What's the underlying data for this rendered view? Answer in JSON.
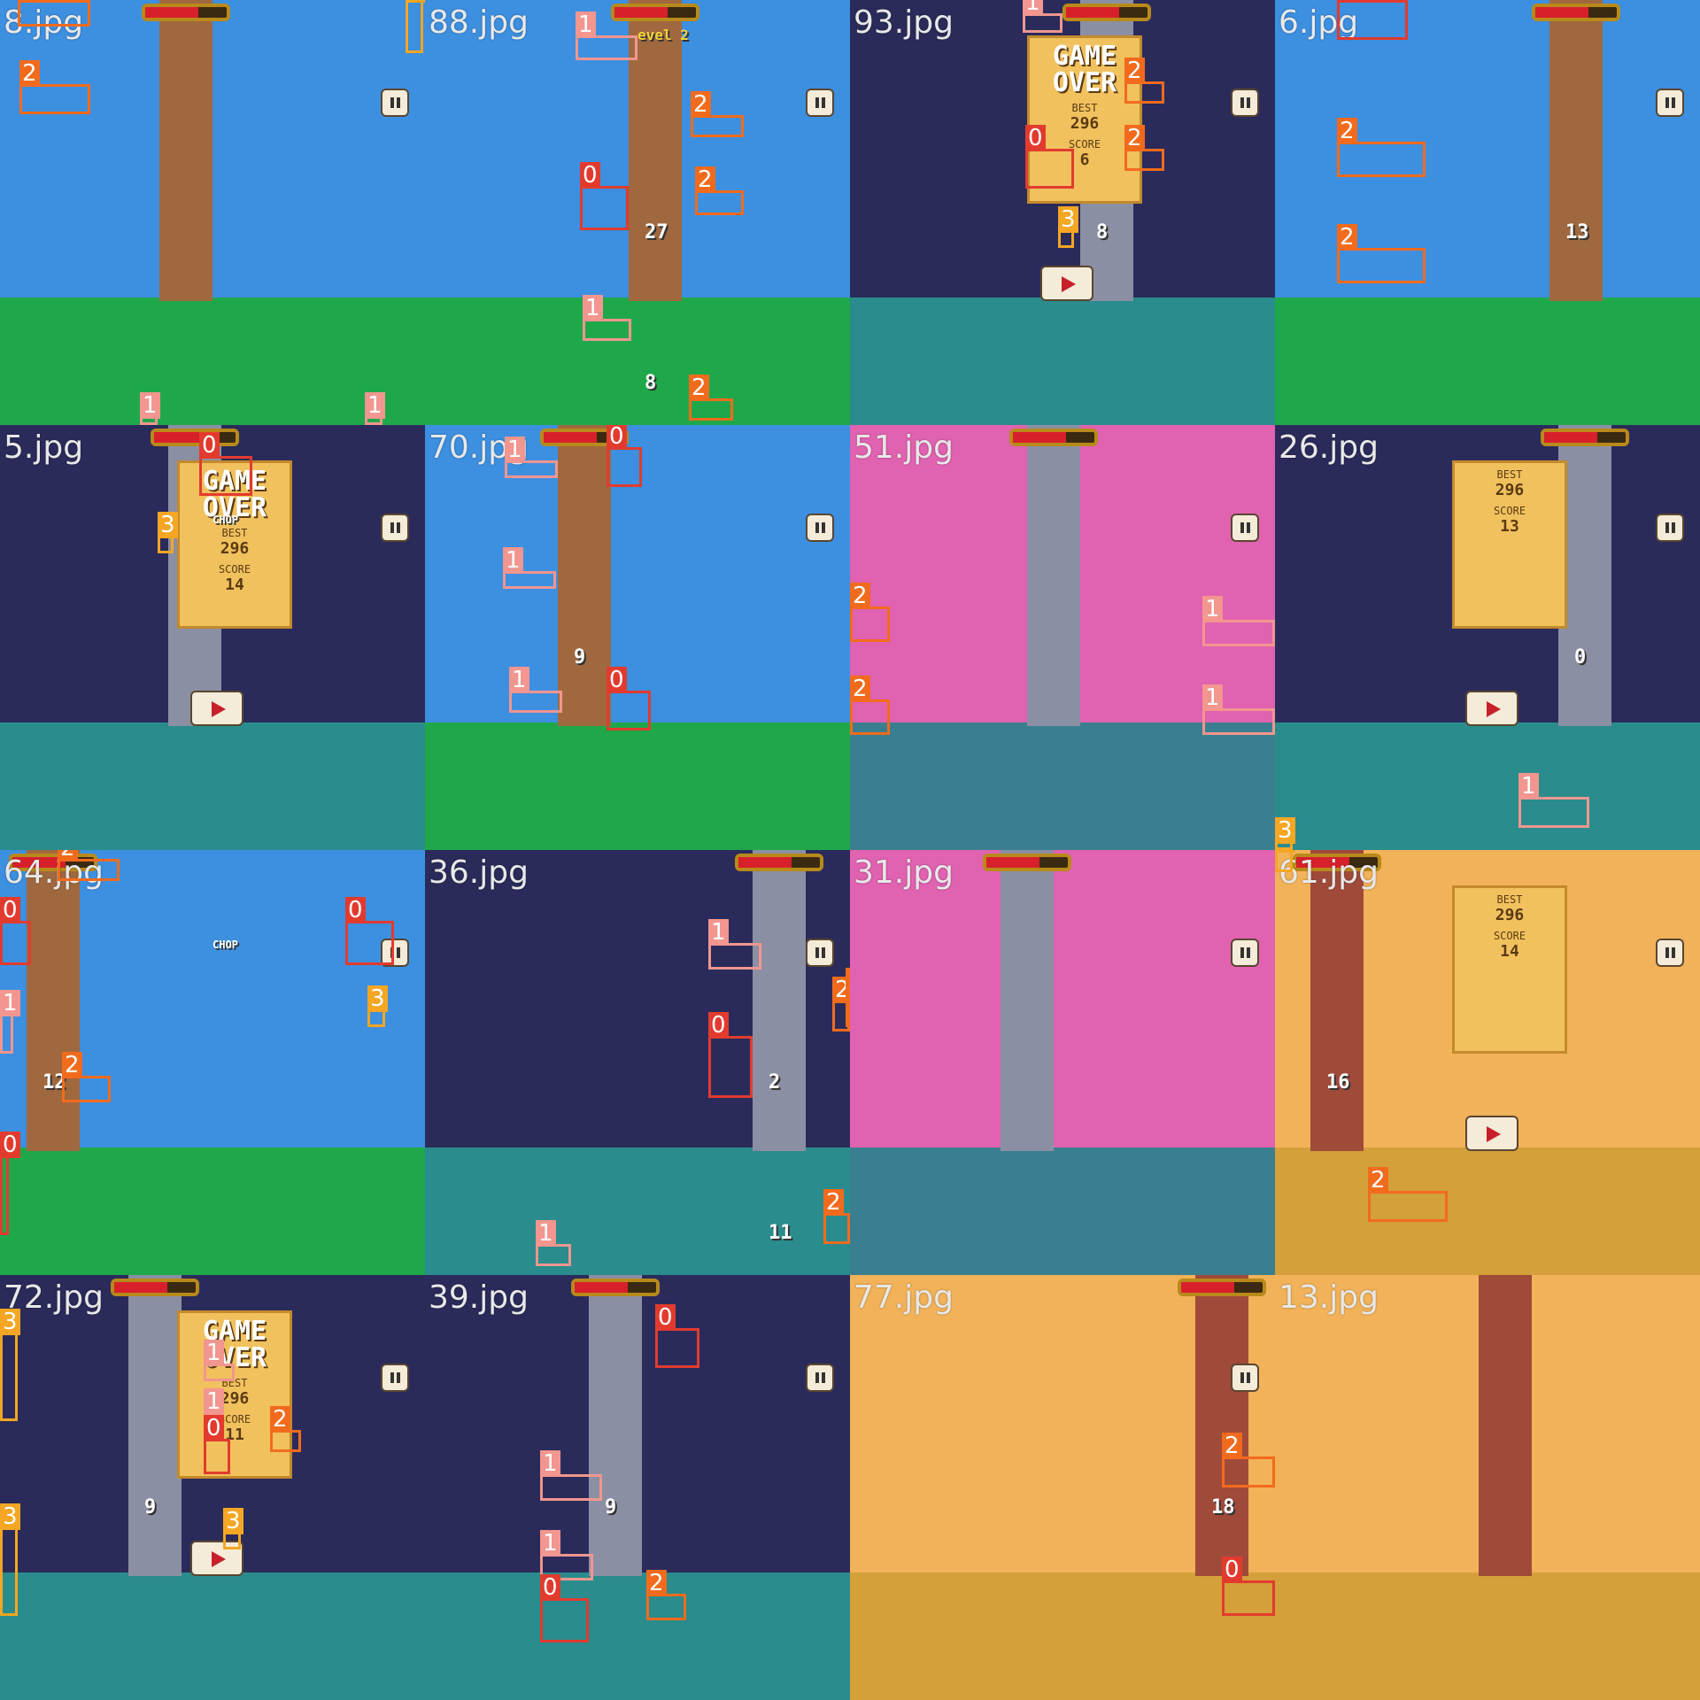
{
  "mosaic": {
    "tiles": [
      {
        "file": "8.jpg",
        "label": "8.jpg",
        "theme": "day",
        "boxes": [
          {
            "cls": "2"
          },
          {
            "cls": "2"
          },
          {
            "cls": "3"
          },
          {
            "cls": "1"
          },
          {
            "cls": "1"
          }
        ],
        "hud": {
          "score": "",
          "best": "",
          "final": "",
          "game_over": ""
        }
      },
      {
        "file": "88.jpg",
        "label": "88.jpg",
        "theme": "day",
        "boxes": [
          {
            "cls": "1"
          },
          {
            "cls": "2"
          },
          {
            "cls": "0"
          },
          {
            "cls": "2"
          },
          {
            "cls": "1"
          },
          {
            "cls": "2"
          }
        ],
        "hud": {
          "score": "27",
          "level": "evel 2",
          "score2": "8"
        }
      },
      {
        "file": "93.jpg",
        "label": "93.jpg",
        "theme": "night",
        "boxes": [
          {
            "cls": "1"
          },
          {
            "cls": "2"
          },
          {
            "cls": "0"
          },
          {
            "cls": "2"
          },
          {
            "cls": "3"
          }
        ],
        "hud": {
          "score": "8",
          "game_over": "GAME OVER",
          "best_label": "BEST",
          "best": "296",
          "score_label": "SCORE",
          "final": "6"
        }
      },
      {
        "file": "6.jpg",
        "label": "6.jpg",
        "theme": "day",
        "boxes": [
          {
            "cls": "0"
          },
          {
            "cls": "2"
          },
          {
            "cls": "2"
          }
        ],
        "hud": {
          "score": "13"
        }
      },
      {
        "file": "5.jpg",
        "label": "5.jpg",
        "theme": "night",
        "boxes": [
          {
            "cls": "0"
          },
          {
            "cls": "3"
          }
        ],
        "hud": {
          "game_over": "GAME OVER",
          "best_label": "BEST",
          "best": "296",
          "score_label": "SCORE",
          "final": "14",
          "chop": "CHOP"
        }
      },
      {
        "file": "70.jpg",
        "label": "70.jpg",
        "theme": "day",
        "boxes": [
          {
            "cls": "1"
          },
          {
            "cls": "0"
          },
          {
            "cls": "1"
          },
          {
            "cls": "1"
          },
          {
            "cls": "0"
          }
        ],
        "hud": {
          "score": "9"
        }
      },
      {
        "file": "51.jpg",
        "label": "51.jpg",
        "theme": "city",
        "boxes": [
          {
            "cls": "2"
          },
          {
            "cls": "2"
          },
          {
            "cls": "1"
          },
          {
            "cls": "1"
          }
        ],
        "hud": {}
      },
      {
        "file": "26.jpg",
        "label": "26.jpg",
        "theme": "night",
        "boxes": [
          {
            "cls": "1"
          },
          {
            "cls": "3"
          }
        ],
        "hud": {
          "best_label": "BEST",
          "best": "296",
          "score_label": "SCORE",
          "final": "13",
          "score": "0"
        }
      },
      {
        "file": "64.jpg",
        "label": "64.jpg",
        "theme": "day",
        "boxes": [
          {
            "cls": "2"
          },
          {
            "cls": "0"
          },
          {
            "cls": "0"
          },
          {
            "cls": "1"
          },
          {
            "cls": "2"
          },
          {
            "cls": "3"
          },
          {
            "cls": "0"
          }
        ],
        "hud": {
          "score": "12",
          "chop": "CHOP"
        }
      },
      {
        "file": "36.jpg",
        "label": "36.jpg",
        "theme": "night",
        "boxes": [
          {
            "cls": "1"
          },
          {
            "cls": "2"
          },
          {
            "cls": "2"
          },
          {
            "cls": "0"
          },
          {
            "cls": "2"
          },
          {
            "cls": "1"
          }
        ],
        "hud": {
          "score": "2",
          "score2": "11"
        }
      },
      {
        "file": "31.jpg",
        "label": "31.jpg",
        "theme": "city",
        "boxes": [],
        "hud": {}
      },
      {
        "file": "61.jpg",
        "label": "61.jpg",
        "theme": "sunset",
        "boxes": [
          {
            "cls": "3"
          },
          {
            "cls": "2"
          }
        ],
        "hud": {
          "best_label": "BEST",
          "best": "296",
          "score_label": "SCORE",
          "final": "14",
          "score": "16"
        }
      },
      {
        "file": "72.jpg",
        "label": "72.jpg",
        "theme": "night",
        "boxes": [
          {
            "cls": "3"
          },
          {
            "cls": "1"
          },
          {
            "cls": "1"
          },
          {
            "cls": "0"
          },
          {
            "cls": "2"
          },
          {
            "cls": "3"
          },
          {
            "cls": "3"
          }
        ],
        "hud": {
          "score": "9",
          "game_over": "GAME OVER",
          "best_label": "BEST",
          "best": "296",
          "score_label": "SCORE",
          "final": "11"
        }
      },
      {
        "file": "39.jpg",
        "label": "39.jpg",
        "theme": "night",
        "boxes": [
          {
            "cls": "0"
          },
          {
            "cls": "1"
          },
          {
            "cls": "1"
          },
          {
            "cls": "0"
          },
          {
            "cls": "2"
          }
        ],
        "hud": {
          "score": "9"
        }
      },
      {
        "file": "77.jpg",
        "label": "77.jpg",
        "theme": "sunset",
        "boxes": [
          {
            "cls": "2"
          },
          {
            "cls": "0"
          }
        ],
        "hud": {
          "score": "18"
        }
      },
      {
        "file": "13.jpg",
        "label": "13.jpg",
        "theme": "sunset",
        "boxes": [],
        "hud": {}
      }
    ]
  },
  "legend_colors": {
    "0": "#e23b2e",
    "1": "#f2968f",
    "2": "#f26b1d",
    "3": "#f5a623"
  },
  "themes": {
    "day": {
      "sky": "#3d8fe0",
      "ground": "#1fa84a",
      "trunk": "#a0683e"
    },
    "night": {
      "sky": "#2a2b5a",
      "ground": "#2a8c8c",
      "trunk": "#8b8fa3"
    },
    "city": {
      "sky": "#e062b0",
      "ground": "#3a7f8f",
      "trunk": "#8b8fa3"
    },
    "sunset": {
      "sky": "#f2b25a",
      "ground": "#d4a03a",
      "trunk": "#a04a3a"
    }
  }
}
